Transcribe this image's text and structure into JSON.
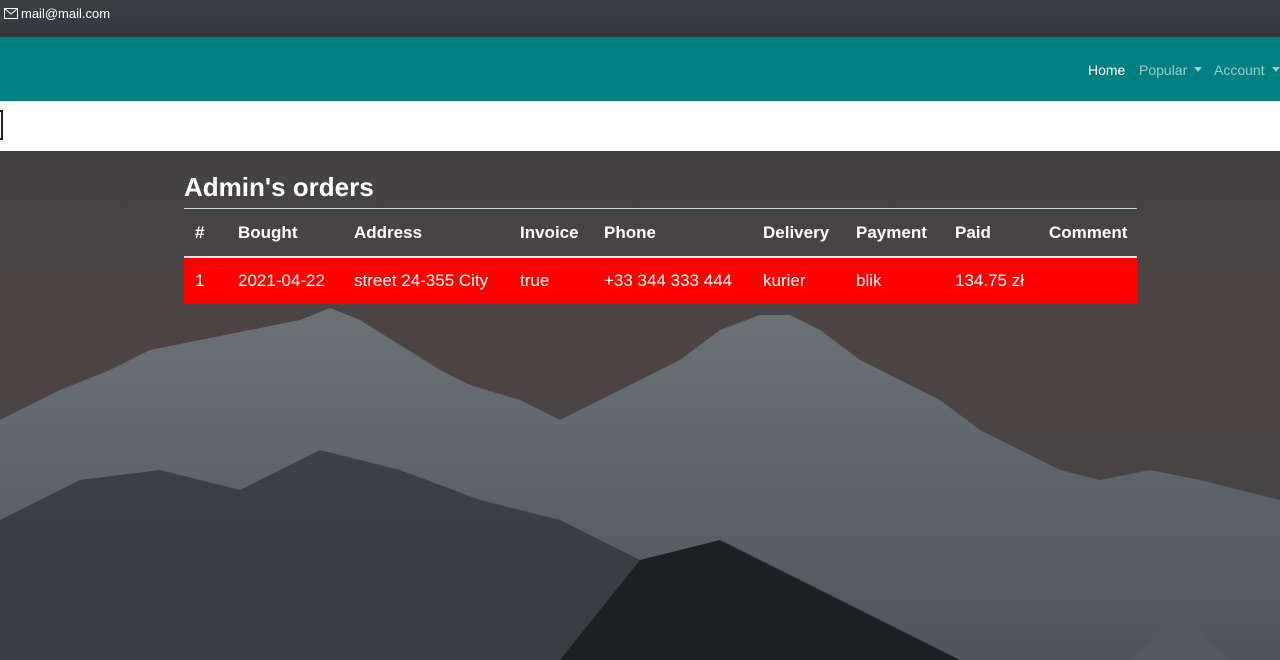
{
  "topbar": {
    "email": "mail@mail.com",
    "icon": "mail-icon"
  },
  "navbar": {
    "background": "#008080",
    "items": [
      {
        "label": "Home",
        "active": true
      },
      {
        "label": "Popular",
        "dropdown": true
      },
      {
        "label": "Account",
        "dropdown": true
      }
    ]
  },
  "page": {
    "title": "Admin's orders",
    "row_highlight": "#ff0000"
  },
  "table": {
    "columns": [
      "#",
      "Bought",
      "Address",
      "Invoice",
      "Phone",
      "Delivery",
      "Payment",
      "Paid",
      "Comment"
    ],
    "rows": [
      [
        "1",
        "2021-04-22",
        "street 24-355 City",
        "true",
        "+33 344 333 444",
        "kurier",
        "blik",
        "134.75 zł",
        ""
      ]
    ]
  }
}
